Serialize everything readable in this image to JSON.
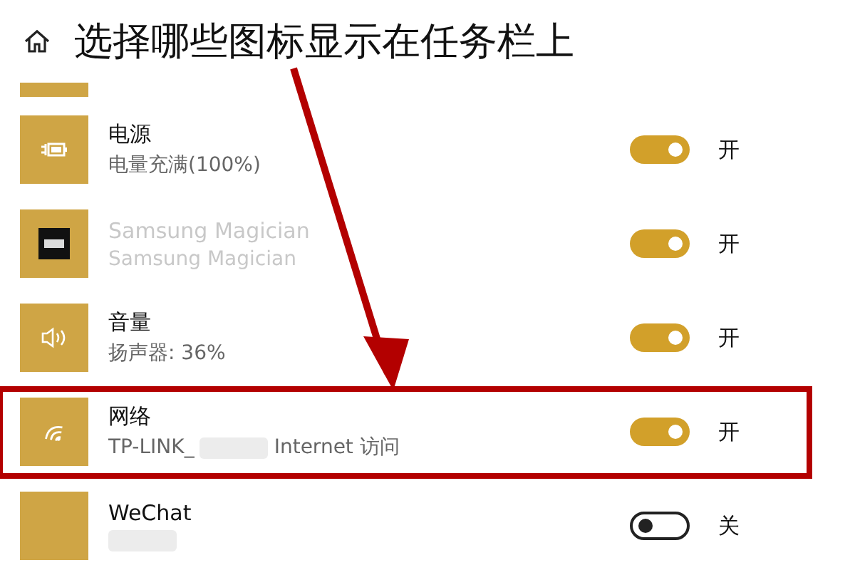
{
  "header": {
    "title": "选择哪些图标显示在任务栏上"
  },
  "items": [
    {
      "kind": "partial"
    },
    {
      "kind": "battery",
      "title": "电源",
      "subtitle": "电量充满(100%)",
      "on": true,
      "state_label": "开"
    },
    {
      "kind": "ssd",
      "title": "Samsung Magician",
      "subtitle": "Samsung Magician",
      "blurred": true,
      "on": true,
      "state_label": "开"
    },
    {
      "kind": "volume",
      "title": "音量",
      "subtitle": "扬声器: 36%",
      "on": true,
      "state_label": "开"
    },
    {
      "kind": "wifi",
      "title": "网络",
      "subtitle": "TP-LINK_",
      "redacted": true,
      "subtitle_end": "Internet 访问",
      "on": true,
      "state_label": "开",
      "highlighted": true
    },
    {
      "kind": "blank",
      "title": "WeChat",
      "redacted": true,
      "on": false,
      "state_label": "关"
    }
  ]
}
